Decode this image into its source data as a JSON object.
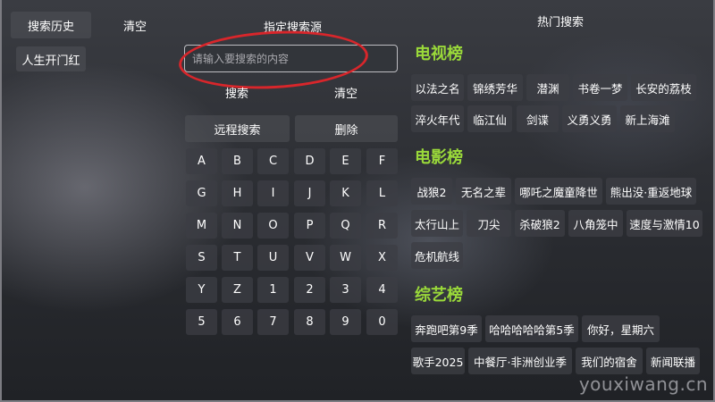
{
  "header": {
    "history_label": "搜索历史",
    "clear_history_label": "清空",
    "source_label": "指定搜索源",
    "hot_label": "热门搜索"
  },
  "history": {
    "items": [
      "人生开门红"
    ]
  },
  "search": {
    "placeholder": "请输入要搜索的内容",
    "search_label": "搜索",
    "clear_label": "清空",
    "remote_label": "远程搜索",
    "delete_label": "删除"
  },
  "keyboard": {
    "rows": [
      [
        "A",
        "B",
        "C",
        "D",
        "E",
        "F"
      ],
      [
        "G",
        "H",
        "I",
        "J",
        "K",
        "L"
      ],
      [
        "M",
        "N",
        "O",
        "P",
        "Q",
        "R"
      ],
      [
        "S",
        "T",
        "U",
        "V",
        "W",
        "X"
      ],
      [
        "Y",
        "Z",
        "1",
        "2",
        "3",
        "4"
      ],
      [
        "5",
        "6",
        "7",
        "8",
        "9",
        "0"
      ]
    ]
  },
  "hot": {
    "tv": {
      "title": "电视榜",
      "row1": [
        "以法之名",
        "锦绣芳华",
        "潜渊",
        "书卷一梦",
        "长安的荔枝"
      ],
      "row2": [
        "淬火年代",
        "临江仙",
        "剑谍",
        "义勇义勇",
        "新上海滩"
      ]
    },
    "movie": {
      "title": "电影榜",
      "row1": [
        "战狼2",
        "无名之辈",
        "哪吒之魔童降世",
        "熊出没·重返地球"
      ],
      "row2": [
        "太行山上",
        "刀尖",
        "杀破狼2",
        "八角笼中",
        "速度与激情10"
      ],
      "row3": [
        "危机航线"
      ]
    },
    "variety": {
      "title": "综艺榜",
      "row1": [
        "奔跑吧第9季",
        "哈哈哈哈哈第5季",
        "你好，星期六"
      ],
      "row2": [
        "歌手2025",
        "中餐厅·非洲创业季",
        "我们的宿舍",
        "新闻联播"
      ]
    }
  },
  "watermark": "youxiwang.cn",
  "colors": {
    "section_title": "#9ad93a",
    "annotation_oval": "#d8262b"
  }
}
